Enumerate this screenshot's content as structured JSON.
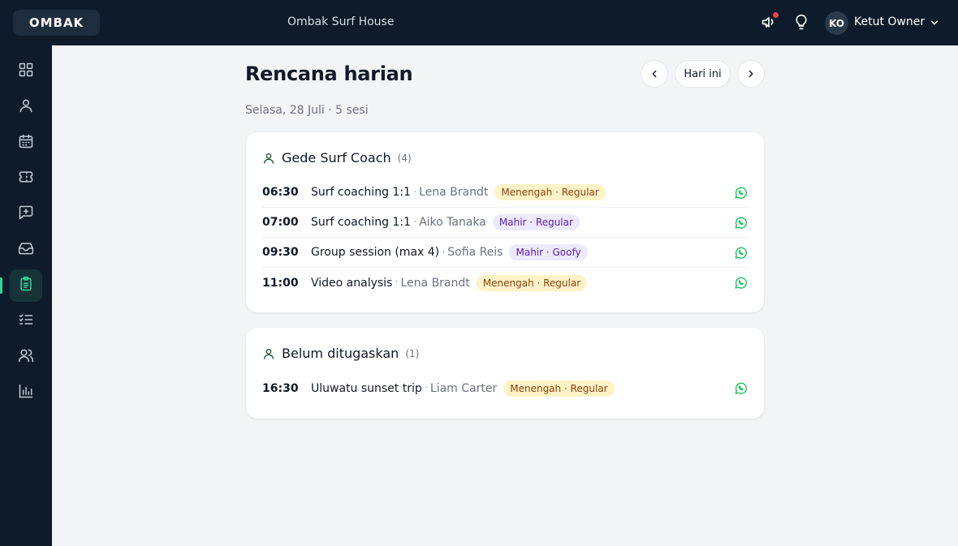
{
  "topbar": {
    "logo": "OMBAK",
    "venue": "Ombak Surf House",
    "announce_icon": "megaphone-icon",
    "tips_icon": "lightbulb-icon",
    "user": {
      "initials": "KO",
      "name": "Ketut Owner"
    }
  },
  "sidebar": {
    "active": "reports-clipboard",
    "items": [
      {
        "id": "dashboard",
        "icon": "grid-icon"
      },
      {
        "id": "profile",
        "icon": "user-icon"
      },
      {
        "id": "calendar",
        "icon": "calendar-icon"
      },
      {
        "id": "tickets",
        "icon": "ticket-icon"
      },
      {
        "id": "messages",
        "icon": "message-plus-icon"
      },
      {
        "id": "inbox",
        "icon": "inbox-icon"
      },
      {
        "id": "reports-clipboard",
        "icon": "clipboard-icon"
      },
      {
        "id": "tasks",
        "icon": "checklist-icon"
      },
      {
        "id": "team",
        "icon": "users-icon"
      },
      {
        "id": "stats",
        "icon": "bar-chart-icon"
      }
    ]
  },
  "page": {
    "title": "Rencana harian",
    "subtitle": "Selasa, 28 Juli · 5 sesi",
    "today_label": "Hari ini"
  },
  "groups": [
    {
      "name": "Gede Surf Coach",
      "count": "(4)",
      "sessions": [
        {
          "time": "06:30",
          "title": "Surf coaching 1:1",
          "client": "Lena Brandt",
          "badge": "Menengah · Regular",
          "badge_color": "#fef3c7"
        },
        {
          "time": "07:00",
          "title": "Surf coaching 1:1",
          "client": "Aiko Tanaka",
          "badge": "Mahir · Regular",
          "badge_color": "#ede9fe"
        },
        {
          "time": "09:30",
          "title": "Group session (max 4)",
          "client": "Sofia Reis",
          "badge": "Mahir · Goofy",
          "badge_color": "#ede9fe"
        },
        {
          "time": "11:00",
          "title": "Video analysis",
          "client": "Lena Brandt",
          "badge": "Menengah · Regular",
          "badge_color": "#fef3c7"
        }
      ]
    },
    {
      "name": "Belum ditugaskan",
      "count": "(1)",
      "sessions": [
        {
          "time": "16:30",
          "title": "Uluwatu sunset trip",
          "client": "Liam Carter",
          "badge": "Menengah · Regular",
          "badge_color": "#fef3c7"
        }
      ]
    }
  ],
  "colors": {
    "sidebar_bg": "#0d1b2a",
    "accent": "#34d399",
    "whatsapp": "#22c55e"
  }
}
